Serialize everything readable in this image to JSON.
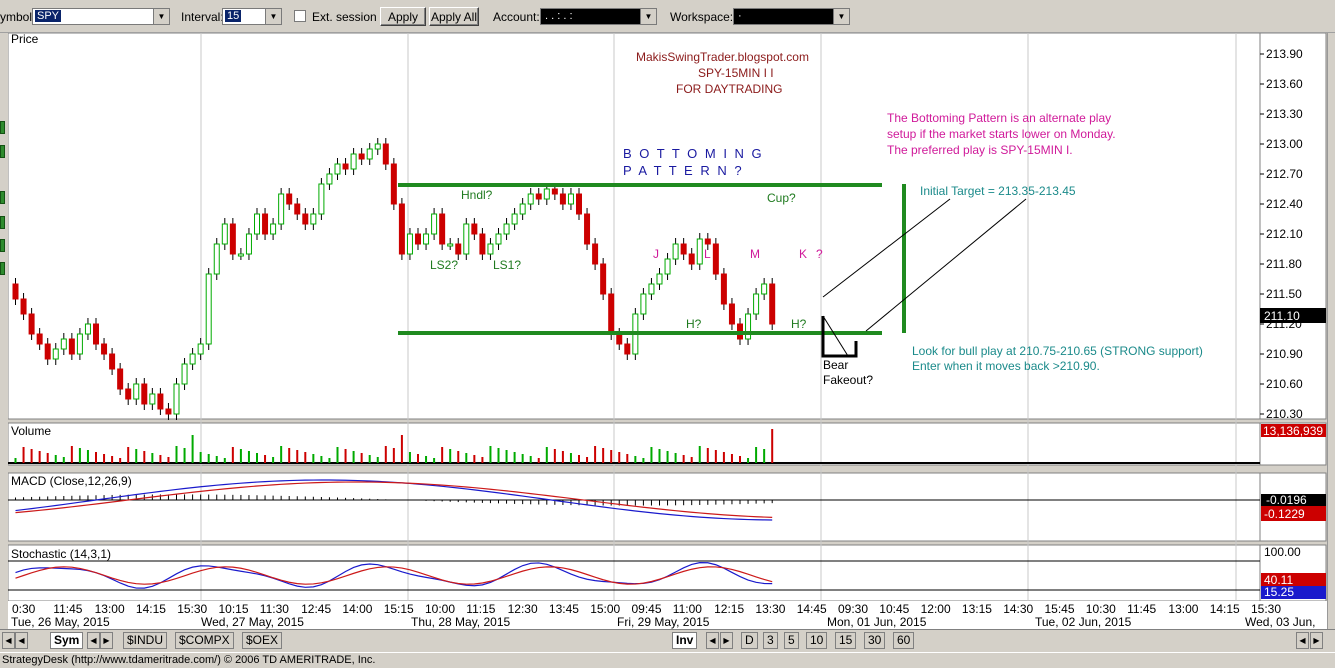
{
  "toolbar": {
    "symbol_label": "ymbol:",
    "symbol_value": "SPY",
    "interval_label": "Interval:",
    "interval_value": "15",
    "ext_session_label": "Ext. session",
    "apply_label": "Apply",
    "apply_all_label": "Apply All",
    "account_label": "Account:",
    "account_value": ". . : . :",
    "workspace_label": "Workspace:",
    "workspace_value": "·"
  },
  "price_panel": {
    "title": "Price",
    "y_ticks": [
      "213.90",
      "213.60",
      "213.30",
      "213.00",
      "212.70",
      "212.40",
      "212.10",
      "211.80",
      "211.50",
      "211.20",
      "210.90",
      "210.60",
      "210.30"
    ],
    "last_price": "211.10"
  },
  "annotations": {
    "header_line1": "MakisSwingTrader.blogspot.com",
    "header_line2": "SPY-15MIN  I I",
    "header_line3": "FOR DAYTRADING",
    "bottoming_line1": "B O T T O M I N G",
    "bottoming_line2": "P A T T E R N ?",
    "note_line1": "The Bottoming Pattern is an alternate play",
    "note_line2": "setup if the market starts lower on Monday.",
    "note_line3": "The preferred play is SPY-15MIN I.",
    "target": "Initial Target = 213.35-213.45",
    "hndl": "Hndl?",
    "ls2": "LS2?",
    "ls1": "LS1?",
    "cup": "Cup?",
    "h1": "H?",
    "h2": "H?",
    "j": "J",
    "k": "K",
    "k_q": "?",
    "l": "L",
    "m": "M",
    "bear1": "Bear",
    "bear2": "Fakeout?",
    "bull1": "Look for bull play at 210.75-210.65 (STRONG support)",
    "bull2": "Enter when it moves back >210.90."
  },
  "volume_panel": {
    "title": "Volume",
    "value": "13,136,939"
  },
  "macd_panel": {
    "title": "MACD (Close,12,26,9)",
    "value1": "-0.0196",
    "value2": "-0.1229"
  },
  "stoch_panel": {
    "title": "Stochastic (14,3,1)",
    "top": "100.00",
    "value1": "40.11",
    "value2": "15.25"
  },
  "time_axis": {
    "ticks": [
      "0:30",
      "11:45",
      "13:00",
      "14:15",
      "15:30",
      "10:15",
      "11:30",
      "12:45",
      "14:00",
      "15:15",
      "10:00",
      "11:15",
      "12:30",
      "13:45",
      "15:00",
      "09:45",
      "11:00",
      "12:15",
      "13:30",
      "14:45",
      "09:30",
      "10:45",
      "12:00",
      "13:15",
      "14:30",
      "15:45",
      "10:30",
      "11:45",
      "13:00",
      "14:15",
      "15:30"
    ],
    "dates": [
      "Tue, 26 May, 2015",
      "Wed, 27 May, 2015",
      "Thu, 28 May, 2015",
      "Fri, 29 May, 2015",
      "Mon, 01 Jun, 2015",
      "Tue, 02 Jun, 2015",
      "Wed, 03 Jun,"
    ]
  },
  "bottom_tabs": {
    "sym": "Sym",
    "indu": "$INDU",
    "compx": "$COMPX",
    "oex": "$OEX",
    "inv": "Inv",
    "intervals": [
      "D",
      "3",
      "5",
      "10",
      "15",
      "30",
      "60"
    ]
  },
  "status_text": "StrategyDesk (http://www.tdameritrade.com/) © 2006 TD AMERITRADE, Inc.",
  "colors": {
    "up": "#00aa00",
    "down": "#cc0000",
    "box": "#1f8a1f",
    "annot_maroon": "#8b1a1a",
    "annot_magenta": "#d01a9a",
    "annot_teal": "#1a8a8a",
    "annot_blue": "#1a1aa0"
  }
}
